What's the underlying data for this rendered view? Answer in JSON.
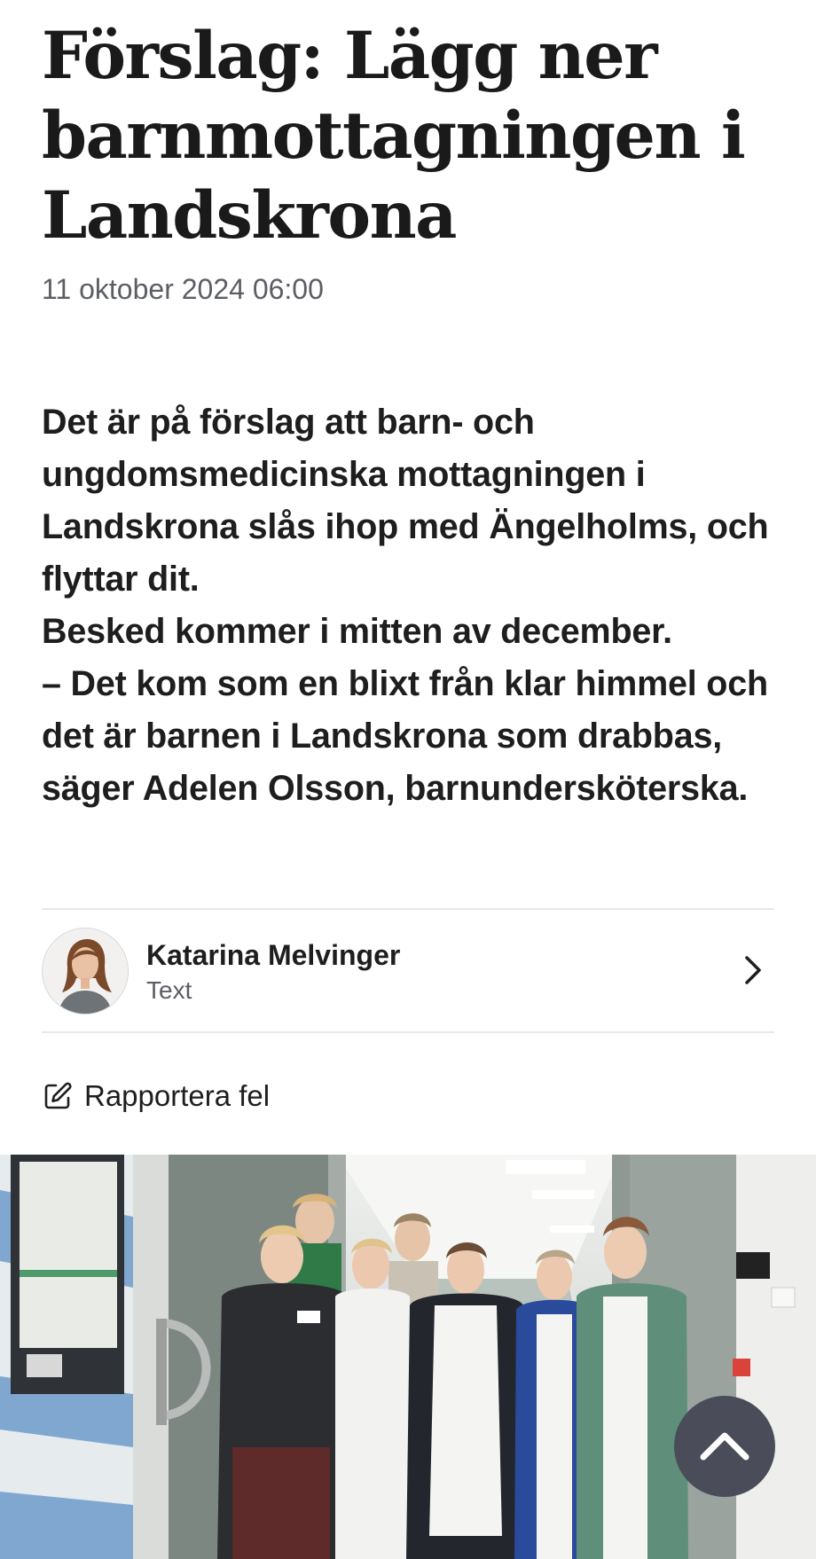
{
  "article": {
    "headline": "Förslag: Lägg ner barnmottagningen i Landskrona",
    "date": "11 oktober 2024 06:00",
    "lead_paragraphs": [
      "Det är på förslag att barn- och ungdomsmedicinska mottagningen i Landskrona slås ihop med Ängelholms, och flyttar dit.",
      "Besked kommer i mitten av december.",
      "– Det kom som en blixt från klar himmel och det är barnen i Landskrona som drabbas, säger Adelen Olsson, barnundersköterska."
    ]
  },
  "author": {
    "name": "Katarina Melvinger",
    "role": "Text",
    "icon": "chevron-right-icon"
  },
  "report": {
    "label": "Rapportera fel",
    "icon": "edit-icon"
  },
  "scroll_top": {
    "icon": "chevron-up-icon"
  },
  "colors": {
    "text": "#1e1e1e",
    "muted": "#5c5e66",
    "divider": "#e8e8ea",
    "scroll_button": "#4a4c59"
  }
}
